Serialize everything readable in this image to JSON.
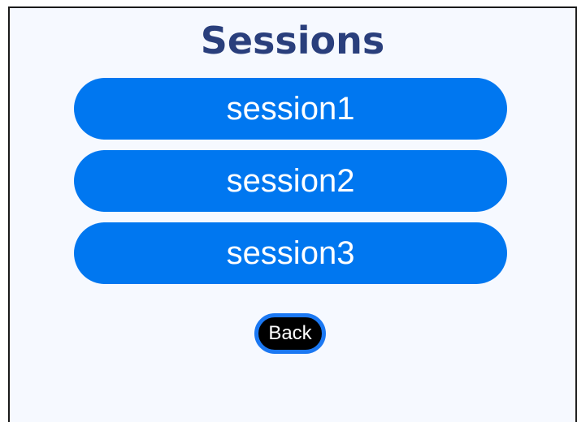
{
  "page": {
    "title": "Sessions"
  },
  "sessions": [
    {
      "label": "session1"
    },
    {
      "label": "session2"
    },
    {
      "label": "session3"
    }
  ],
  "actions": {
    "back_label": "Back"
  },
  "colors": {
    "background": "#f6f9ff",
    "title": "#2a3f7c",
    "session_button": "#0077f0",
    "back_button_fill": "#000000",
    "back_button_border": "#1b78f2"
  }
}
